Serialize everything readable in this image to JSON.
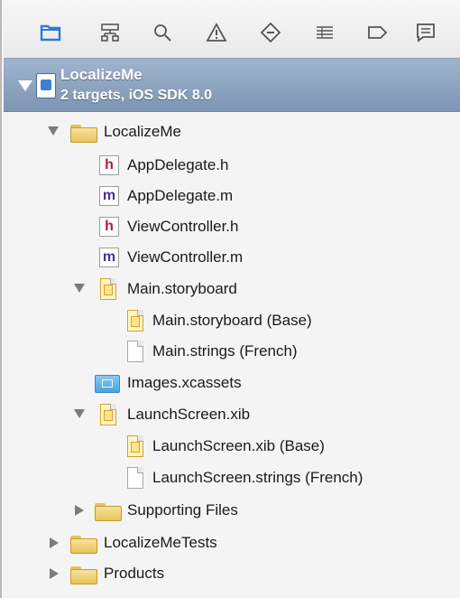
{
  "toolbar": {
    "icons": [
      "folder-icon",
      "hierarchy-icon",
      "search-icon",
      "warning-icon",
      "breakpoint-diamond-icon",
      "list-icon",
      "tag-icon",
      "comment-icon"
    ]
  },
  "project": {
    "name": "LocalizeMe",
    "subtitle": "2 targets, iOS SDK 8.0"
  },
  "tree": {
    "localizeme_group": "LocalizeMe",
    "appdelegate_h": "AppDelegate.h",
    "appdelegate_m": "AppDelegate.m",
    "viewcontroller_h": "ViewController.h",
    "viewcontroller_m": "ViewController.m",
    "main_storyboard": "Main.storyboard",
    "main_storyboard_base": "Main.storyboard (Base)",
    "main_strings_french": "Main.strings (French)",
    "images_xcassets": "Images.xcassets",
    "launchscreen_xib": "LaunchScreen.xib",
    "launchscreen_xib_base": "LaunchScreen.xib (Base)",
    "launchscreen_strings_french": "LaunchScreen.strings (French)",
    "supporting_files": "Supporting Files",
    "localizeme_tests": "LocalizeMeTests",
    "products": "Products"
  },
  "badges": {
    "h": "h",
    "m": "m"
  },
  "colors": {
    "selected_row": "#8fa6c4",
    "toolbar_active": "#2d79d6"
  }
}
